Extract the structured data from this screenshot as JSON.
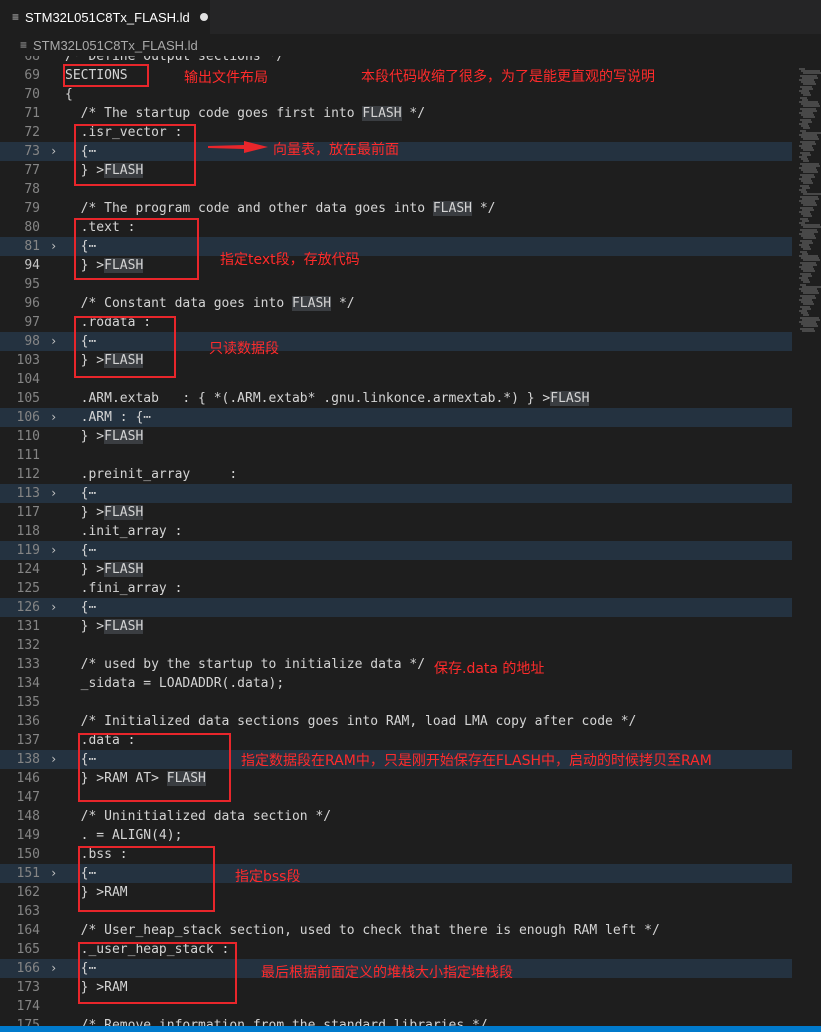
{
  "tab": {
    "title": "STM32L051C8Tx_FLASH.ld",
    "icon": "lines-file-icon"
  },
  "breadcrumb": {
    "file": "STM32L051C8Tx_FLASH.ld",
    "icon": "lines-file-icon"
  },
  "lines": [
    {
      "n": "68",
      "code": "/* Define output sections */",
      "fold": false,
      "folded_bg": false
    },
    {
      "n": "69",
      "code": "SECTIONS",
      "fold": false,
      "folded_bg": false
    },
    {
      "n": "70",
      "code": "{",
      "fold": false,
      "folded_bg": false
    },
    {
      "n": "71",
      "code": "  /* The startup code goes first into FLASH */",
      "fold": false,
      "folded_bg": false,
      "hl": "FLASH"
    },
    {
      "n": "72",
      "code": "  .isr_vector :",
      "fold": false,
      "folded_bg": false
    },
    {
      "n": "73",
      "code": "  {⋯",
      "fold": true,
      "folded_bg": true
    },
    {
      "n": "77",
      "code": "  } >FLASH",
      "fold": false,
      "folded_bg": false,
      "hl": "FLASH"
    },
    {
      "n": "78",
      "code": "",
      "fold": false,
      "folded_bg": false
    },
    {
      "n": "79",
      "code": "  /* The program code and other data goes into FLASH */",
      "fold": false,
      "folded_bg": false,
      "hl": "FLASH"
    },
    {
      "n": "80",
      "code": "  .text :",
      "fold": false,
      "folded_bg": false
    },
    {
      "n": "81",
      "code": "  {⋯",
      "fold": true,
      "folded_bg": true
    },
    {
      "n": "94",
      "code": "  } >FLASH",
      "fold": false,
      "folded_bg": false,
      "hl": "FLASH",
      "active": true
    },
    {
      "n": "95",
      "code": "",
      "fold": false,
      "folded_bg": false
    },
    {
      "n": "96",
      "code": "  /* Constant data goes into FLASH */",
      "fold": false,
      "folded_bg": false,
      "hl": "FLASH"
    },
    {
      "n": "97",
      "code": "  .rodata :",
      "fold": false,
      "folded_bg": false
    },
    {
      "n": "98",
      "code": "  {⋯",
      "fold": true,
      "folded_bg": true
    },
    {
      "n": "103",
      "code": "  } >FLASH",
      "fold": false,
      "folded_bg": false,
      "hl": "FLASH"
    },
    {
      "n": "104",
      "code": "",
      "fold": false,
      "folded_bg": false
    },
    {
      "n": "105",
      "code": "  .ARM.extab   : { *(.ARM.extab* .gnu.linkonce.armextab.*) } >FLASH",
      "fold": false,
      "folded_bg": false,
      "hl": "FLASH"
    },
    {
      "n": "106",
      "code": "  .ARM : {⋯",
      "fold": true,
      "folded_bg": true
    },
    {
      "n": "110",
      "code": "  } >FLASH",
      "fold": false,
      "folded_bg": false,
      "hl": "FLASH"
    },
    {
      "n": "111",
      "code": "",
      "fold": false,
      "folded_bg": false
    },
    {
      "n": "112",
      "code": "  .preinit_array     :",
      "fold": false,
      "folded_bg": false
    },
    {
      "n": "113",
      "code": "  {⋯",
      "fold": true,
      "folded_bg": true
    },
    {
      "n": "117",
      "code": "  } >FLASH",
      "fold": false,
      "folded_bg": false,
      "hl": "FLASH"
    },
    {
      "n": "118",
      "code": "  .init_array :",
      "fold": false,
      "folded_bg": false
    },
    {
      "n": "119",
      "code": "  {⋯",
      "fold": true,
      "folded_bg": true
    },
    {
      "n": "124",
      "code": "  } >FLASH",
      "fold": false,
      "folded_bg": false,
      "hl": "FLASH"
    },
    {
      "n": "125",
      "code": "  .fini_array :",
      "fold": false,
      "folded_bg": false
    },
    {
      "n": "126",
      "code": "  {⋯",
      "fold": true,
      "folded_bg": true
    },
    {
      "n": "131",
      "code": "  } >FLASH",
      "fold": false,
      "folded_bg": false,
      "hl": "FLASH"
    },
    {
      "n": "132",
      "code": "",
      "fold": false,
      "folded_bg": false
    },
    {
      "n": "133",
      "code": "  /* used by the startup to initialize data */",
      "fold": false,
      "folded_bg": false
    },
    {
      "n": "134",
      "code": "  _sidata = LOADADDR(.data);",
      "fold": false,
      "folded_bg": false
    },
    {
      "n": "135",
      "code": "",
      "fold": false,
      "folded_bg": false
    },
    {
      "n": "136",
      "code": "  /* Initialized data sections goes into RAM, load LMA copy after code */",
      "fold": false,
      "folded_bg": false
    },
    {
      "n": "137",
      "code": "  .data :",
      "fold": false,
      "folded_bg": false
    },
    {
      "n": "138",
      "code": "  {⋯",
      "fold": true,
      "folded_bg": true
    },
    {
      "n": "146",
      "code": "  } >RAM AT> FLASH",
      "fold": false,
      "folded_bg": false,
      "hl": "FLASH"
    },
    {
      "n": "147",
      "code": "",
      "fold": false,
      "folded_bg": false
    },
    {
      "n": "148",
      "code": "  /* Uninitialized data section */",
      "fold": false,
      "folded_bg": false
    },
    {
      "n": "149",
      "code": "  . = ALIGN(4);",
      "fold": false,
      "folded_bg": false
    },
    {
      "n": "150",
      "code": "  .bss :",
      "fold": false,
      "folded_bg": false
    },
    {
      "n": "151",
      "code": "  {⋯",
      "fold": true,
      "folded_bg": true
    },
    {
      "n": "162",
      "code": "  } >RAM",
      "fold": false,
      "folded_bg": false
    },
    {
      "n": "163",
      "code": "",
      "fold": false,
      "folded_bg": false
    },
    {
      "n": "164",
      "code": "  /* User_heap_stack section, used to check that there is enough RAM left */",
      "fold": false,
      "folded_bg": false
    },
    {
      "n": "165",
      "code": "  ._user_heap_stack :",
      "fold": false,
      "folded_bg": false
    },
    {
      "n": "166",
      "code": "  {⋯",
      "fold": true,
      "folded_bg": true
    },
    {
      "n": "173",
      "code": "  } >RAM",
      "fold": false,
      "folded_bg": false
    },
    {
      "n": "174",
      "code": "",
      "fold": false,
      "folded_bg": false
    },
    {
      "n": "175",
      "code": "  /* Remove information from the standard libraries */",
      "fold": false,
      "folded_bg": false
    }
  ],
  "annotations": {
    "sections": "输出文件布局",
    "summary": "本段代码收缩了很多，为了是能更直观的写说明",
    "isr": "向量表，放在最前面",
    "text": "指定text段，存放代码",
    "rodata": "只读数据段",
    "sidata": "保存.data 的地址",
    "data": "指定数据段在RAM中，只是刚开始保存在FLASH中，启动的时候拷贝至RAM",
    "bss": "指定bss段",
    "heap": "最后根据前面定义的堆栈大小指定堆栈段"
  },
  "colors": {
    "annotation": "#ff2b2b",
    "box": "#e8262b",
    "folded_line": "#243240",
    "background": "#1e1e1e"
  }
}
